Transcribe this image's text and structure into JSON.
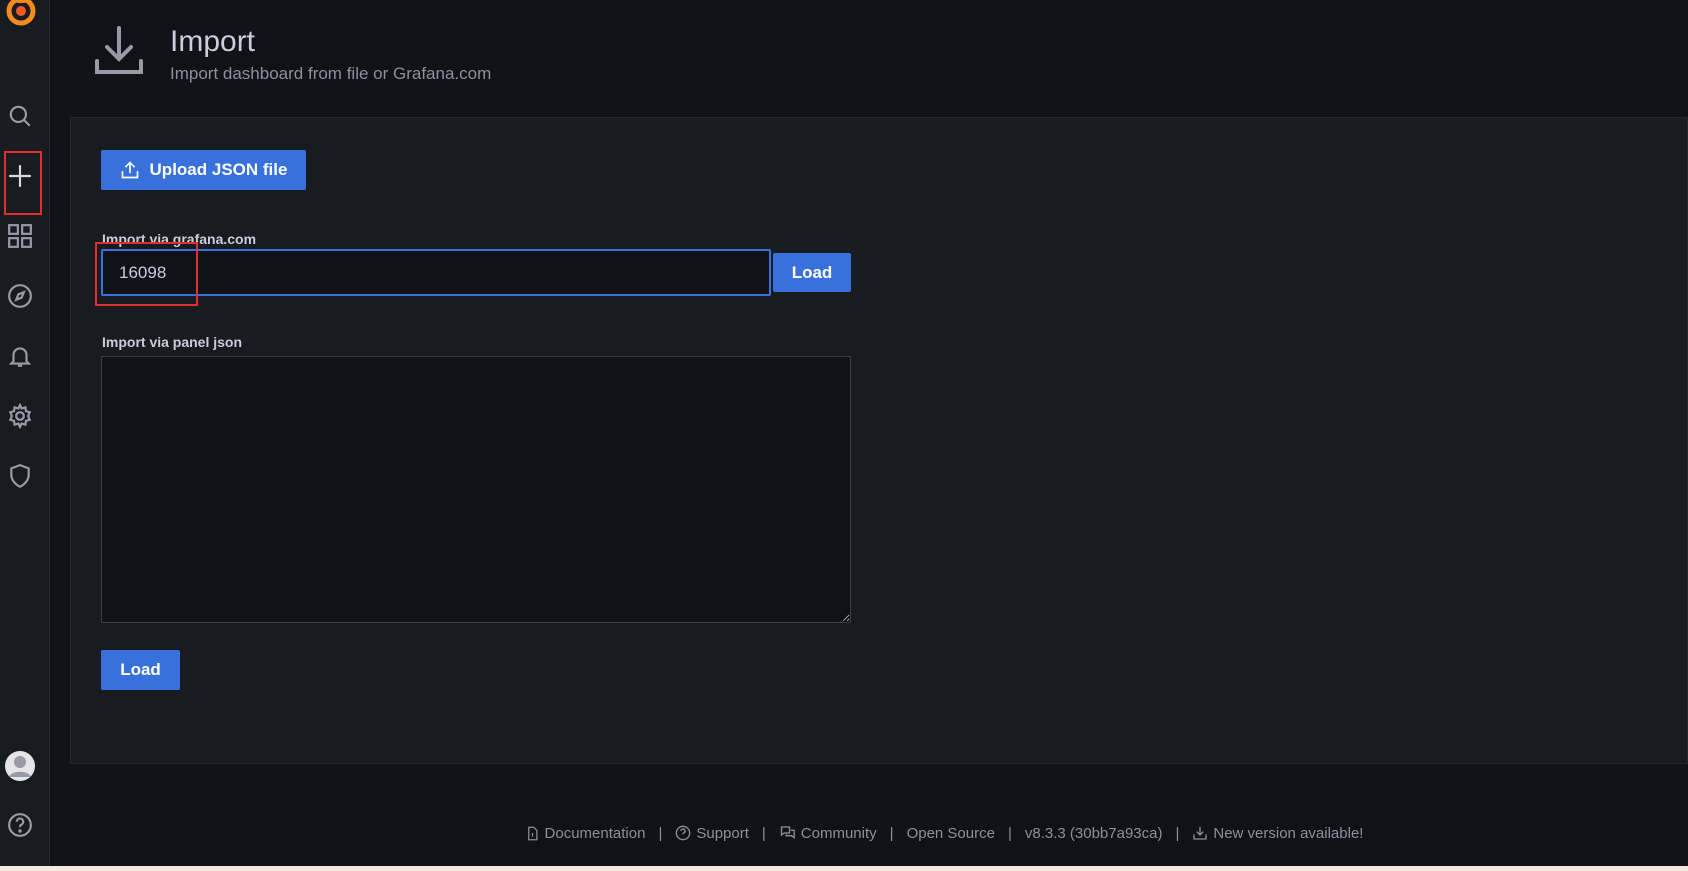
{
  "header": {
    "title": "Import",
    "subtitle": "Import dashboard from file or Grafana.com"
  },
  "sidebar": {
    "items": [
      {
        "icon": "search-icon"
      },
      {
        "icon": "plus-icon"
      },
      {
        "icon": "dashboards-icon"
      },
      {
        "icon": "explore-icon"
      },
      {
        "icon": "bell-icon"
      },
      {
        "icon": "gear-icon"
      },
      {
        "icon": "shield-icon"
      }
    ],
    "bottom": [
      {
        "icon": "avatar"
      },
      {
        "icon": "help-icon"
      }
    ]
  },
  "import": {
    "upload_label": "Upload JSON file",
    "gcom_label": "Import via grafana.com",
    "gcom_value": "16098",
    "load_label_1": "Load",
    "json_label": "Import via panel json",
    "json_value": "",
    "load_label_2": "Load"
  },
  "footer": {
    "documentation": "Documentation",
    "support": "Support",
    "community": "Community",
    "open_source": "Open Source",
    "version": "v8.3.3 (30bb7a93ca)",
    "new_version": "New version available!",
    "separator": "|"
  },
  "colors": {
    "accent": "#3871dc",
    "highlight": "#e02f2f",
    "background": "#111217",
    "panel": "#181b1f"
  }
}
